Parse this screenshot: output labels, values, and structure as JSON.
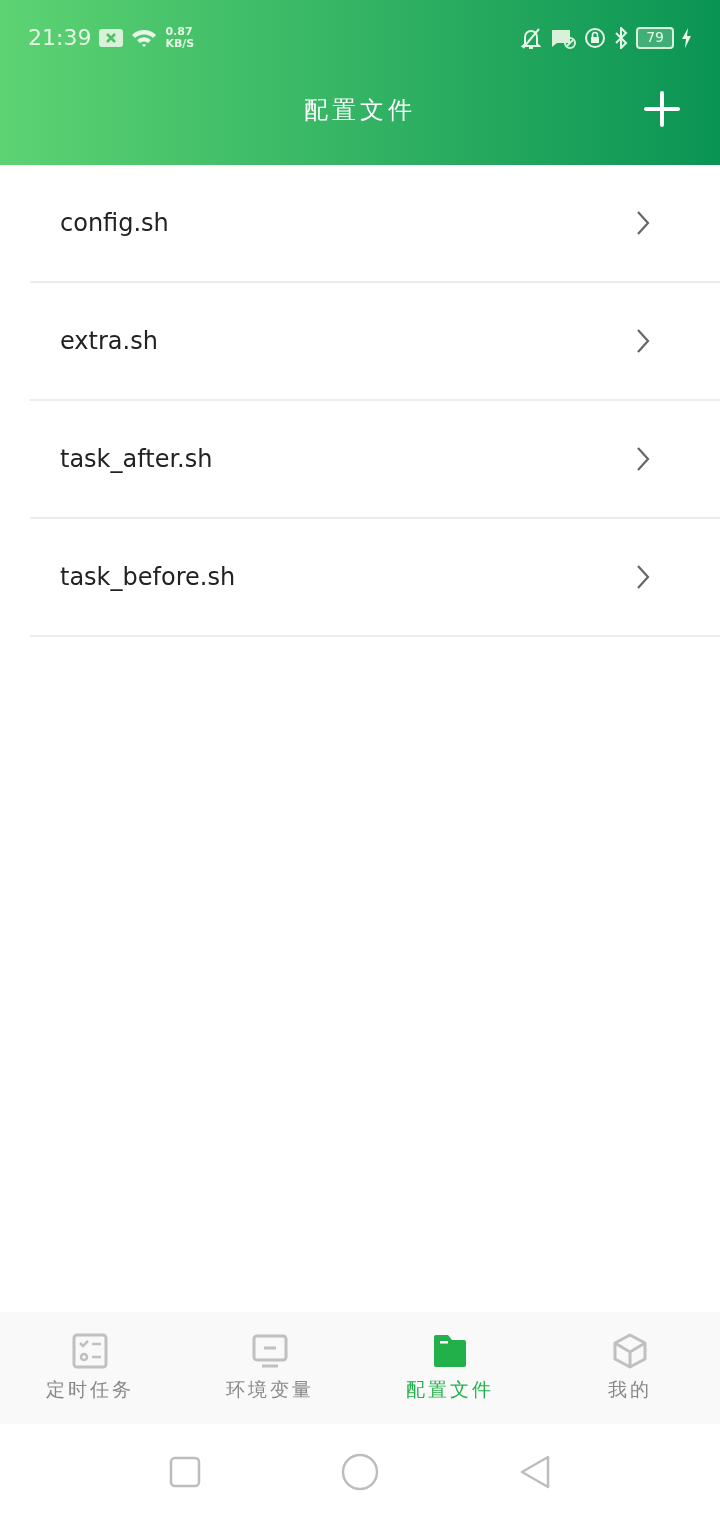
{
  "status_bar": {
    "time": "21:39",
    "speed_value": "0.87",
    "speed_unit": "KB/S",
    "battery": "79"
  },
  "header": {
    "title": "配置文件"
  },
  "files": [
    {
      "name": "config.sh"
    },
    {
      "name": "extra.sh"
    },
    {
      "name": "task_after.sh"
    },
    {
      "name": "task_before.sh"
    }
  ],
  "tabs": [
    {
      "label": "定时任务",
      "kind": "tasks",
      "selected": false
    },
    {
      "label": "环境变量",
      "kind": "env",
      "selected": false
    },
    {
      "label": "配置文件",
      "kind": "files",
      "selected": true
    },
    {
      "label": "我的",
      "kind": "me",
      "selected": false
    }
  ]
}
